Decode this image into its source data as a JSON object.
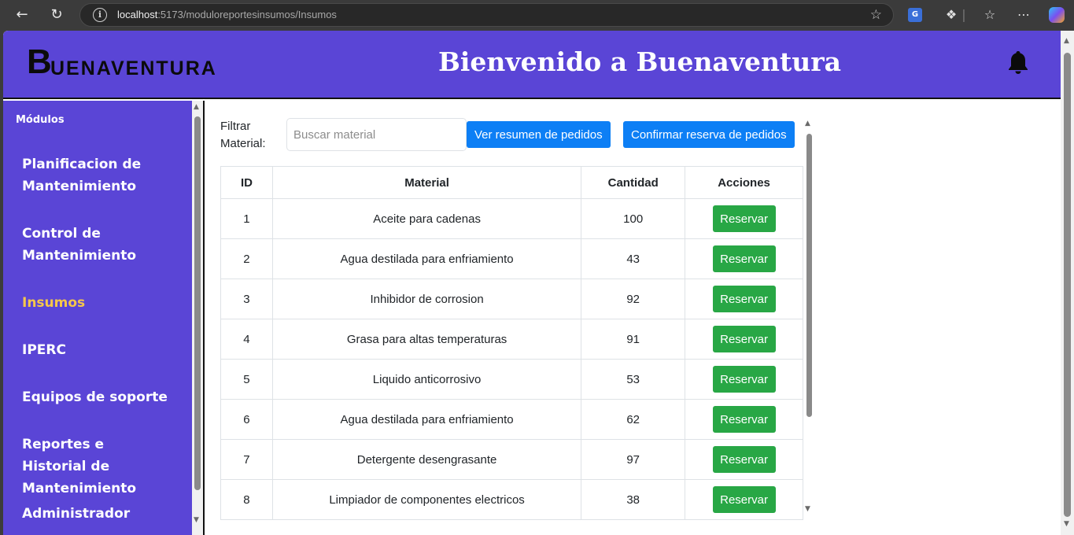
{
  "browser": {
    "url_host": "localhost",
    "url_rest": ":5173/moduloreportesinsumos/Insumos"
  },
  "header": {
    "logo_initial": "B",
    "logo_rest": "UENAVENTURA",
    "title": "Bienvenido a Buenaventura"
  },
  "sidebar": {
    "heading": "Módulos",
    "items": [
      {
        "label": "Planificacion de Mantenimiento",
        "active": false
      },
      {
        "label": "Control de Mantenimiento",
        "active": false
      },
      {
        "label": "Insumos",
        "active": true
      },
      {
        "label": "IPERC",
        "active": false
      },
      {
        "label": "Equipos de soporte",
        "active": false
      },
      {
        "label": "Reportes e Historial de Mantenimiento",
        "active": false
      },
      {
        "label": "Administrador",
        "active": false
      }
    ]
  },
  "filter": {
    "label_line1": "Filtrar",
    "label_line2": "Material:",
    "placeholder": "Buscar material",
    "summary_button": "Ver resumen de pedidos",
    "confirm_button": "Confirmar reserva de pedidos"
  },
  "table": {
    "headers": [
      "ID",
      "Material",
      "Cantidad",
      "Acciones"
    ],
    "rows": [
      {
        "id": "1",
        "material": "Aceite para cadenas",
        "cantidad": "100",
        "action": "Reservar"
      },
      {
        "id": "2",
        "material": "Agua destilada para enfriamiento",
        "cantidad": "43",
        "action": "Reservar"
      },
      {
        "id": "3",
        "material": "Inhibidor de corrosion",
        "cantidad": "92",
        "action": "Reservar"
      },
      {
        "id": "4",
        "material": "Grasa para altas temperaturas",
        "cantidad": "91",
        "action": "Reservar"
      },
      {
        "id": "5",
        "material": "Liquido anticorrosivo",
        "cantidad": "53",
        "action": "Reservar"
      },
      {
        "id": "6",
        "material": "Agua destilada para enfriamiento",
        "cantidad": "62",
        "action": "Reservar"
      },
      {
        "id": "7",
        "material": "Detergente desengrasante",
        "cantidad": "97",
        "action": "Reservar"
      },
      {
        "id": "8",
        "material": "Limpiador de componentes electricos",
        "cantidad": "38",
        "action": "Reservar"
      }
    ]
  },
  "colors": {
    "brand": "#5a45d6",
    "active_item": "#f6c74a",
    "primary_button": "#0d7ff5",
    "success_button": "#28a745"
  }
}
